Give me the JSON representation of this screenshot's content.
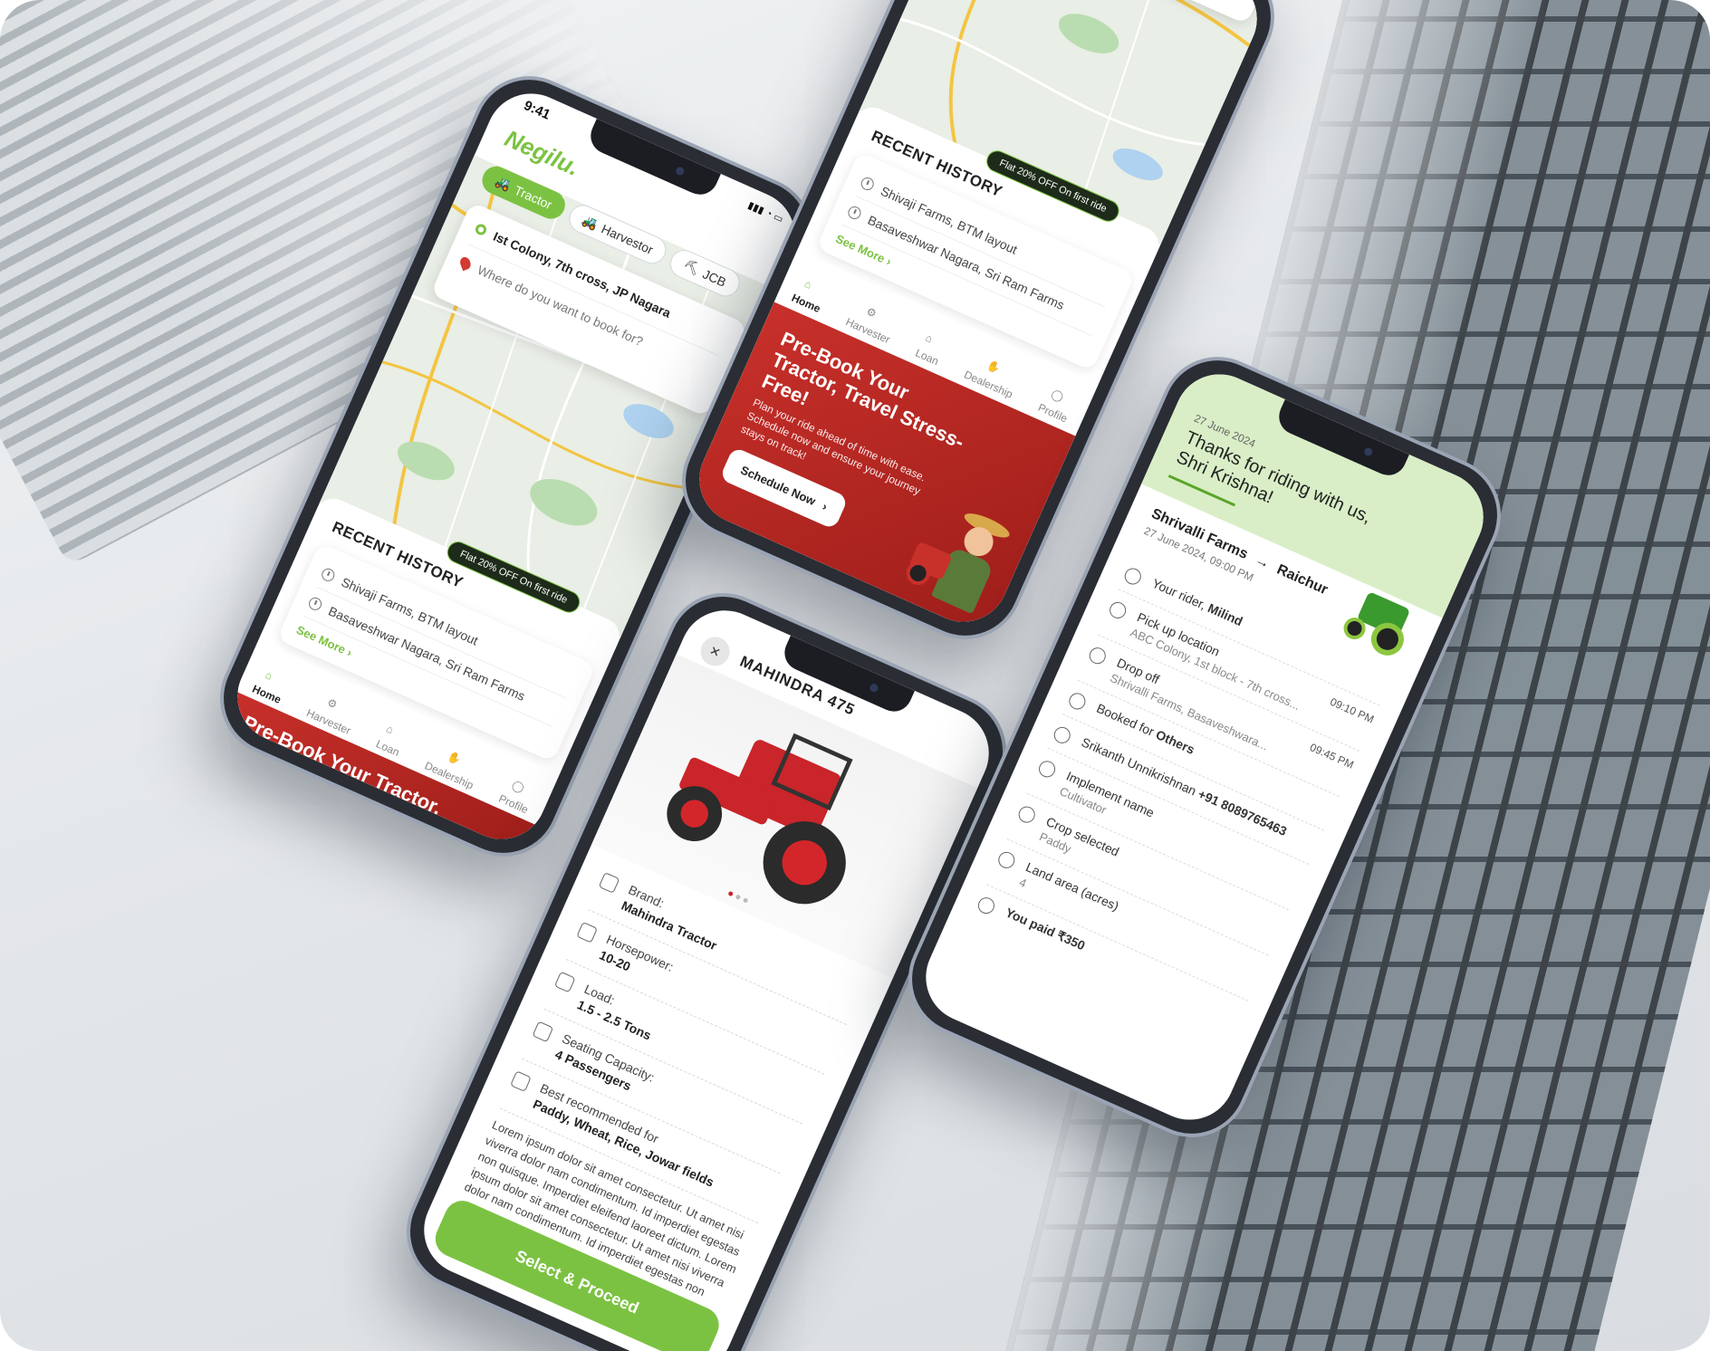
{
  "phone1": {
    "status_time": "9:41",
    "logo": "Negilu.",
    "chips": [
      {
        "label": "Tractor",
        "icon": "tractor-icon"
      },
      {
        "label": "Harvestor",
        "icon": "harvester-icon"
      },
      {
        "label": "JCB",
        "icon": "jcb-icon"
      }
    ],
    "pickup": "Ist Colony, 7th cross, JP Nagara",
    "destination_placeholder": "Where do you want to book for?",
    "offer": "Flat 20% OFF On first ride",
    "recent_title": "RECENT HISTORY",
    "history": [
      "Shivaji Farms, BTM layout",
      "Basaveshwar Nagara, Sri Ram Farms"
    ],
    "see_more": "See More",
    "promo_peek": "Pre-Book Your Tractor,"
  },
  "phone2": {
    "offer": "Flat 20% OFF On first ride",
    "recent_title": "RECENT HISTORY",
    "history": [
      "Shivaji Farms, BTM layout",
      "Basaveshwar Nagara, Sri Ram Farms"
    ],
    "see_more": "See More",
    "promo_title": "Pre-Book Your Tractor, Travel Stress-Free!",
    "promo_sub": "Plan your ride ahead of time with ease. Schedule now and ensure your journey stays on track!",
    "promo_cta": "Schedule Now"
  },
  "tabs": [
    {
      "label": "Home",
      "icon": "home-icon"
    },
    {
      "label": "Harvester",
      "icon": "harvester-icon"
    },
    {
      "label": "Loan",
      "icon": "loan-icon"
    },
    {
      "label": "Dealership",
      "icon": "dealership-icon"
    },
    {
      "label": "Profile",
      "icon": "profile-icon"
    }
  ],
  "phone3": {
    "close": "✕",
    "title": "MAHINDRA 475",
    "specs": [
      {
        "label": "Brand:",
        "value": "Mahindra Tractor",
        "icon": "tractor-icon"
      },
      {
        "label": "Horsepower:",
        "value": "10-20",
        "icon": "bolt-icon"
      },
      {
        "label": "Load:",
        "value": "1.5 - 2.5 Tons",
        "icon": "weight-icon"
      },
      {
        "label": "Seating Capacity:",
        "value": "4 Passengers",
        "icon": "seat-icon"
      },
      {
        "label": "Best recommended for",
        "value": "Paddy, Wheat, Rice, Jowar fields",
        "icon": "leaf-icon"
      }
    ],
    "description": "Lorem ipsum dolor sit amet consectetur. Ut amet nisi viverra dolor nam condimentum. Id imperdiet egestas non quisque. Imperdiet eleifend laoreet dictum. Lorem ipsum dolor sit amet consectetur. Ut amet nisi viverra dolor nam condimentum. Id imperdiet egestas non",
    "cta": "Select & Proceed"
  },
  "phone4": {
    "date": "27 June 2024",
    "thanks": "Thanks for riding with us, Shri Krishna!",
    "from": "Shrivalli Farms",
    "to": "Raichur",
    "arrow": "→",
    "datetime": "27 June 2024, 09:00 PM",
    "rider_label": "Your rider,",
    "rider_name": "Milind",
    "pickup_label": "Pick up location",
    "pickup": "ABC Colony, 1st block - 7th cross...",
    "pickup_time": "09:10 PM",
    "drop_label": "Drop off",
    "drop": "Shrivalli Farms, Basaveshwara...",
    "drop_time": "09:45 PM",
    "booked_label": "Booked for",
    "booked_value": "Others",
    "contact_name": "Srikanth Unnikrishnan",
    "contact_phone": "+91 8089765463",
    "implement_label": "Implement name",
    "implement": "Cultivator",
    "crop_label": "Crop selected",
    "crop": "Paddy",
    "land_label": "Land area (acres)",
    "land": "4",
    "paid": "You paid ₹350"
  },
  "colors": {
    "accent": "#7cc242",
    "promo_red": "#c8302a",
    "dark": "#222222"
  }
}
